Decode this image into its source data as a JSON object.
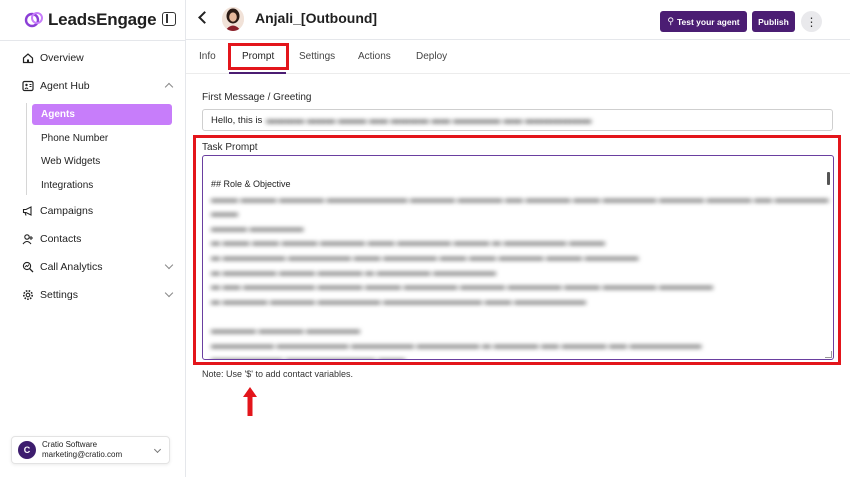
{
  "brand": {
    "name": "LeadsEngage",
    "logo_color": "#8b3fd6"
  },
  "sidebar": {
    "items": [
      {
        "label": "Overview",
        "icon": "home-icon"
      },
      {
        "label": "Agent Hub",
        "icon": "agent-hub-icon",
        "expanded": true
      },
      {
        "label": "Campaigns",
        "icon": "megaphone-icon"
      },
      {
        "label": "Contacts",
        "icon": "user-plus-icon"
      },
      {
        "label": "Call Analytics",
        "icon": "analytics-icon"
      },
      {
        "label": "Settings",
        "icon": "gear-icon"
      }
    ],
    "sub_items": [
      {
        "label": "Agents",
        "active": true
      },
      {
        "label": "Phone Number"
      },
      {
        "label": "Web Widgets"
      },
      {
        "label": "Integrations"
      }
    ],
    "account": {
      "initial": "C",
      "name": "Cratio Software",
      "email": "marketing@cratio.com"
    }
  },
  "header": {
    "agent_name": "Anjali_[Outbound]",
    "test_label": "Test your agent",
    "publish_label": "Publish",
    "more_label": "⋮"
  },
  "tabs": [
    {
      "label": "Info"
    },
    {
      "label": "Prompt",
      "active": true
    },
    {
      "label": "Settings"
    },
    {
      "label": "Actions"
    },
    {
      "label": "Deploy"
    }
  ],
  "form": {
    "greeting_label": "First Message / Greeting",
    "greeting_value": "Hello, this is",
    "task_label": "Task Prompt",
    "task_heading": "## Role & Objective",
    "note": "Note: Use '$' to add contact variables."
  },
  "colors": {
    "accent": "#4b1d73",
    "active_sub": "#c77dfa",
    "highlight": "#e3151b"
  }
}
